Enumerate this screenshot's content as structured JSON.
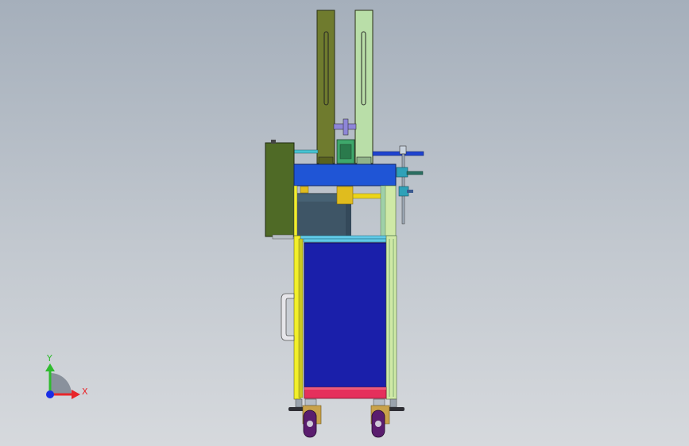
{
  "viewport": {
    "background_top": "#a5afbb",
    "background_bottom": "#d6d9dd"
  },
  "model": {
    "colors": {
      "upright_left": "#6f7b2e",
      "upright_right": "#b9dea8",
      "top_beam": "#1f55d6",
      "motor_housing": "#4f6a26",
      "motor": "#3e5566",
      "shaft": "#ecd51a",
      "frame_left": "#f2ef2a",
      "frame_right": "#cfe9a6",
      "frame_cross": "#62c9e6",
      "panel": "#1a1faa",
      "base_bar": "#e5305c",
      "caster_wheel": "#5a1d6e",
      "caster_fork": "#c9a24a",
      "coupling": "#3ea86b",
      "bolt": "#8e86d8",
      "handle": "#e6e6ea"
    }
  },
  "triad": {
    "x_label": "X",
    "y_label": "Y",
    "x_color": "#e8262b",
    "y_color": "#2fbb2f",
    "z_color": "#1a2ee6"
  }
}
